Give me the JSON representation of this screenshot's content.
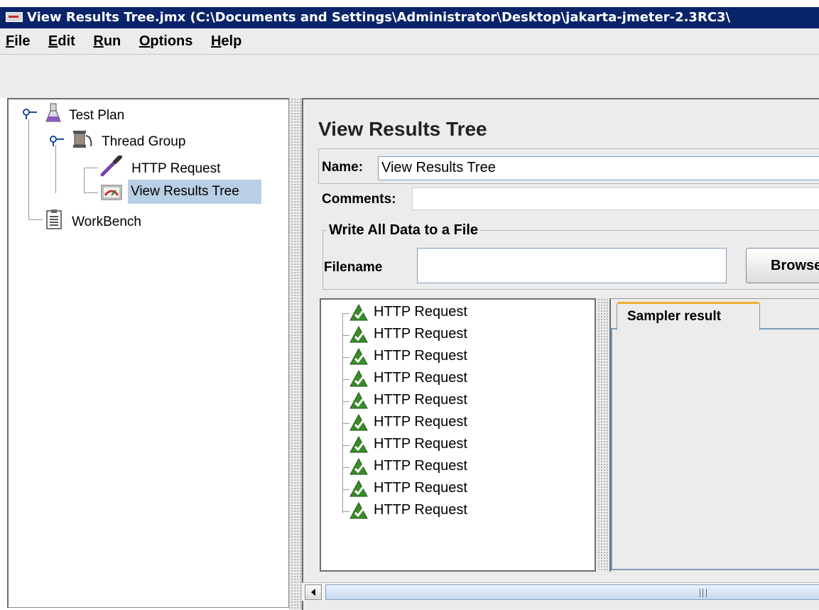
{
  "window": {
    "title": "View Results Tree.jmx (C:\\Documents and Settings\\Administrator\\Desktop\\jakarta-jmeter-2.3RC3\\"
  },
  "menu": {
    "items": [
      {
        "label": "File",
        "mnemonic": "F"
      },
      {
        "label": "Edit",
        "mnemonic": "E"
      },
      {
        "label": "Run",
        "mnemonic": "R"
      },
      {
        "label": "Options",
        "mnemonic": "O"
      },
      {
        "label": "Help",
        "mnemonic": "H"
      }
    ]
  },
  "tree": {
    "test_plan": "Test Plan",
    "thread_group": "Thread Group",
    "http_request": "HTTP Request",
    "view_results_tree": "View Results Tree",
    "workbench": "WorkBench"
  },
  "panel": {
    "title": "View Results Tree",
    "name_label": "Name:",
    "name_value": "View Results Tree",
    "comments_label": "Comments:",
    "comments_value": "",
    "group_title": "Write All Data to a File",
    "filename_label": "Filename",
    "filename_value": "",
    "browse_label": "Browse..."
  },
  "results": {
    "items": [
      "HTTP Request",
      "HTTP Request",
      "HTTP Request",
      "HTTP Request",
      "HTTP Request",
      "HTTP Request",
      "HTTP Request",
      "HTTP Request",
      "HTTP Request",
      "HTTP Request"
    ],
    "tab_label": "Sampler result"
  },
  "colors": {
    "titlebar": "#0a246a",
    "selection": "#b8cfe5",
    "success": "#3a8a2a",
    "tab_accent": "#f0b030"
  }
}
